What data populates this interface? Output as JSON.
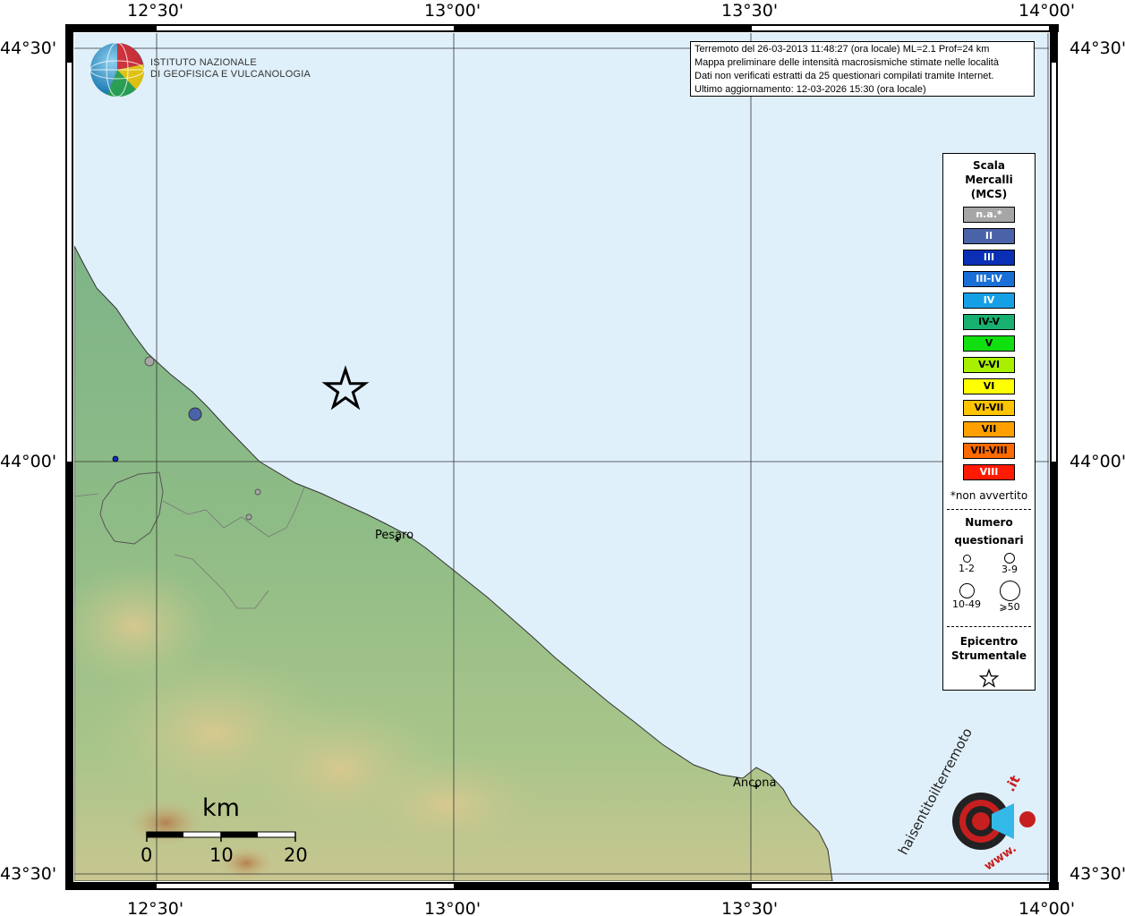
{
  "map": {
    "top_longitudes": [
      "12°30'",
      "13°00'",
      "13°30'",
      "14°00'"
    ],
    "bottom_longitudes": [
      "12°30'",
      "13°00'",
      "13°30'",
      "14°00'"
    ],
    "left_latitudes": [
      "44°30'",
      "44°00'",
      "43°30'"
    ],
    "right_latitudes": [
      "44°30'",
      "44°00'",
      "43°30'"
    ],
    "cities": [
      "Pesaro",
      "Ancona"
    ],
    "colors": {
      "sea": "#e0f0fb",
      "land_low": "#7fb585",
      "land_mid": "#9cc08a",
      "land_high": "#d6c98f",
      "relief": "#b98a5a"
    }
  },
  "header": {
    "logo_line1": "ISTITUTO NAZIONALE",
    "logo_line2": "DI GEOFISICA E VULCANOLOGIA"
  },
  "info": {
    "line1": "Terremoto del 26-03-2013 11:48:27 (ora locale) ML=2.1 Prof=24 km",
    "line2": "Mappa preliminare delle intensità macrosismiche stimate nelle località",
    "line3": "Dati non verificati estratti da 25 questionari compilati tramite Internet.",
    "line4": "Ultimo aggiornamento: 12-03-2026 15:30 (ora locale)"
  },
  "legend": {
    "title_line1": "Scala",
    "title_line2": "Mercalli",
    "title_line3": "(MCS)",
    "items": [
      {
        "label": "n.a.*",
        "color": "#a6a6a6",
        "text_color": "#ffffff"
      },
      {
        "label": "II",
        "color": "#4a63a8",
        "text_color": "#ffffff"
      },
      {
        "label": "III",
        "color": "#0a2fb5",
        "text_color": "#ffffff"
      },
      {
        "label": "III-IV",
        "color": "#1a6fd6",
        "text_color": "#ffffff"
      },
      {
        "label": "IV",
        "color": "#15a0e6",
        "text_color": "#ffffff"
      },
      {
        "label": "IV-V",
        "color": "#18b070",
        "text_color": "#000000"
      },
      {
        "label": "V",
        "color": "#10e010",
        "text_color": "#000000"
      },
      {
        "label": "V-VI",
        "color": "#a8f000",
        "text_color": "#000000"
      },
      {
        "label": "VI",
        "color": "#ffff00",
        "text_color": "#000000"
      },
      {
        "label": "VI-VII",
        "color": "#ffc400",
        "text_color": "#000000"
      },
      {
        "label": "VII",
        "color": "#ffa000",
        "text_color": "#000000"
      },
      {
        "label": "VII-VIII",
        "color": "#ff6a00",
        "text_color": "#000000"
      },
      {
        "label": "VIII",
        "color": "#ff1a00",
        "text_color": "#ffffff"
      }
    ],
    "note": "*non avvertito",
    "count_title_line1": "Numero",
    "count_title_line2": "questionari",
    "count_sizes": [
      "1-2",
      "3-9",
      "10-49",
      "⩾50"
    ],
    "epicenter_line1": "Epicentro",
    "epicenter_line2": "Strumentale",
    "epicenter_icon": "star-outline"
  },
  "scalebar": {
    "unit": "km",
    "ticks": [
      "0",
      "10",
      "20"
    ]
  },
  "watermark": {
    "text_main": "haisentitoilterremoto",
    "text_domain": ".it",
    "text_www": "www."
  }
}
